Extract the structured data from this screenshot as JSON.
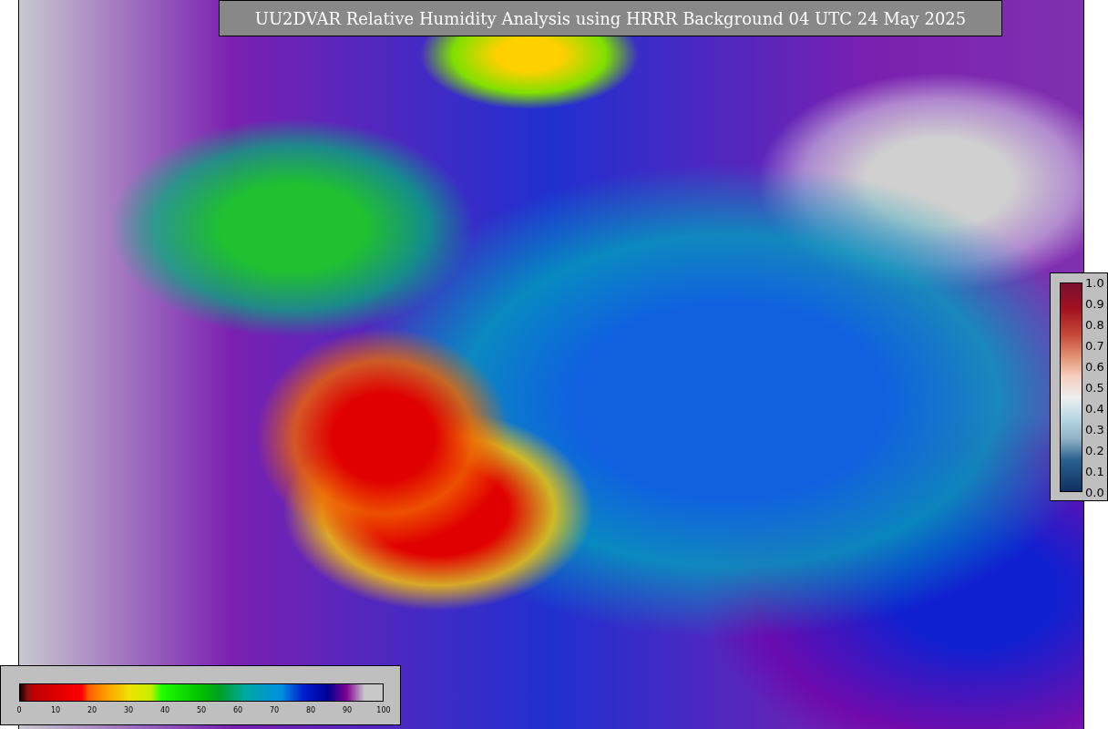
{
  "title": "UU2DVAR Relative Humidity Analysis using HRRR Background 04 UTC 24 May 2025",
  "humidity_colorbar": {
    "ticks": [
      "0",
      "10",
      "20",
      "30",
      "40",
      "50",
      "60",
      "70",
      "80",
      "90",
      "100"
    ]
  },
  "difference_colorbar": {
    "ticks": [
      "1.0",
      "0.9",
      "0.8",
      "0.7",
      "0.6",
      "0.5",
      "0.4",
      "0.3",
      "0.2",
      "0.1",
      "0.0"
    ]
  }
}
